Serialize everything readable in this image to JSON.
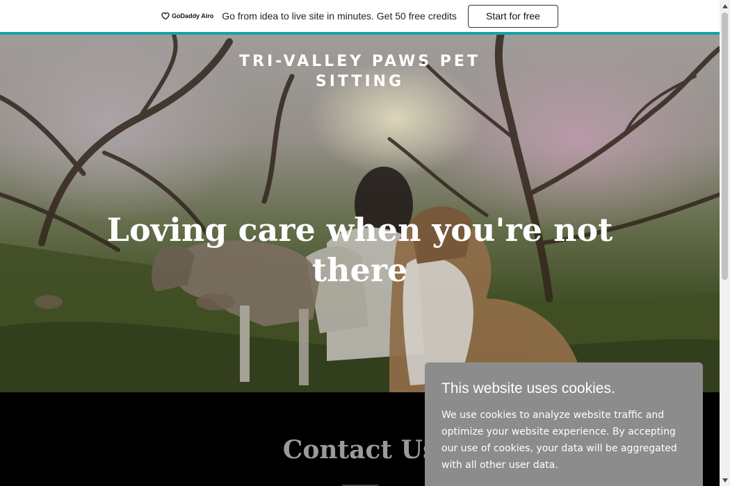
{
  "promo_bar": {
    "brand": "GoDaddy Airo",
    "message": "Go from idea to live site in minutes. Get 50 free credits",
    "cta_label": "Start for free"
  },
  "hero": {
    "site_title": [
      "TRI-VALLEY PAWS PET",
      "SITTING"
    ],
    "headline": [
      "Loving care when you're not",
      "there"
    ]
  },
  "contact": {
    "title": "Contact Us"
  },
  "cookie_banner": {
    "title": "This website uses cookies.",
    "text": "We use cookies to analyze website traffic and optimize your website experience. By accepting our use of cookies, your data will be aggregated with all other user data."
  },
  "colors": {
    "accent": "#12a4a8",
    "cookie_bg": "#8c8c8c",
    "contact_bg": "#000000"
  }
}
